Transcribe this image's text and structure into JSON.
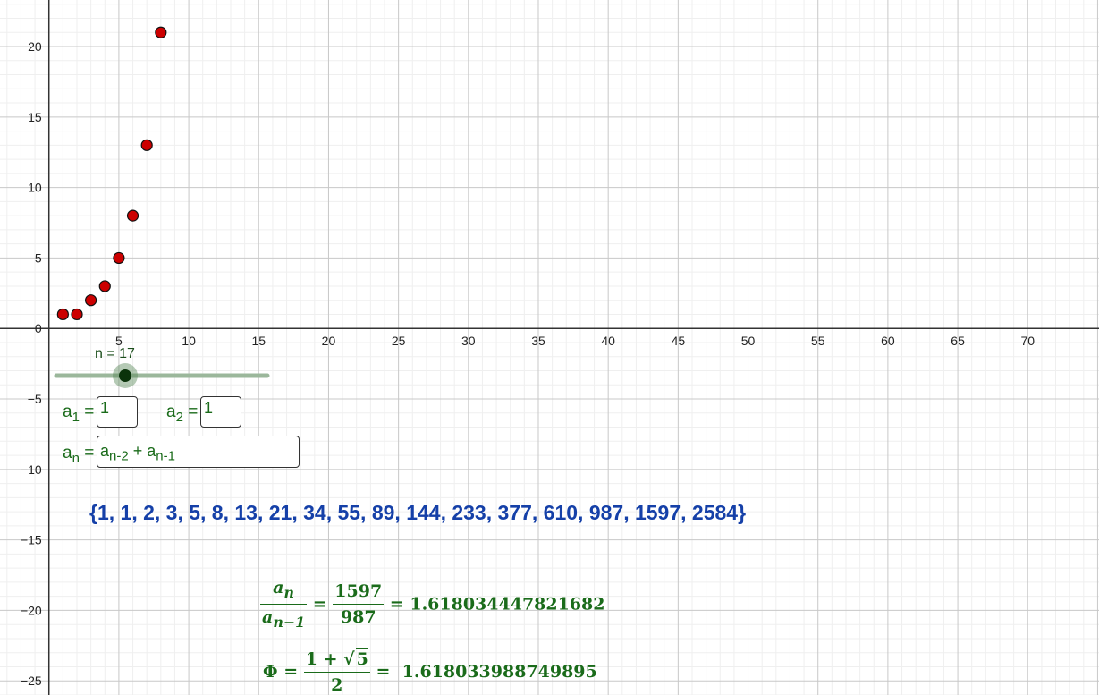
{
  "graphics_view": {
    "x_tick_labels": [
      "5",
      "10",
      "15",
      "20",
      "25",
      "30",
      "35",
      "40",
      "45",
      "50",
      "55",
      "60",
      "65",
      "70"
    ],
    "y_tick_labels": [
      "20",
      "15",
      "10",
      "5",
      "0",
      "−5",
      "−10",
      "−15",
      "−20",
      "−25"
    ],
    "x_range": [
      -3.5,
      75.1
    ],
    "y_range": [
      -26,
      23.3
    ],
    "grid": true,
    "point_color": "#cc0000"
  },
  "chart_data": {
    "type": "scatter",
    "points": [
      {
        "x": 1,
        "y": 1
      },
      {
        "x": 2,
        "y": 1
      },
      {
        "x": 3,
        "y": 2
      },
      {
        "x": 4,
        "y": 3
      },
      {
        "x": 5,
        "y": 5
      },
      {
        "x": 6,
        "y": 8
      },
      {
        "x": 7,
        "y": 13
      },
      {
        "x": 8,
        "y": 21
      }
    ]
  },
  "slider": {
    "label": "n = 17",
    "value": 17
  },
  "inputs": {
    "a1": {
      "label_base": "a",
      "label_sub": "1",
      "value": "1"
    },
    "a2": {
      "label_base": "a",
      "label_sub": "2",
      "value": "1"
    },
    "an": {
      "label_base": "a",
      "label_sub": "n",
      "value_part1": "a",
      "value_sub1": "n-2",
      "value_mid": " + a",
      "value_sub2": "n-1"
    }
  },
  "sequence_text": "{1, 1, 2, 3, 5, 8, 13, 21, 34, 55, 89, 144, 233, 377, 610, 987, 1597, 2584}",
  "ratio": {
    "num_symbol": "a",
    "num_sub": "n",
    "den_symbol": "a",
    "den_sub": "n−1",
    "numerator": "1597",
    "denominator": "987",
    "value": "1.618034447821682"
  },
  "phi": {
    "symbol": "Φ",
    "num_text": "1 + √",
    "num_radicand": "5",
    "denominator": "2",
    "value": "1.618033988749895"
  },
  "colors": {
    "sequence": "#1540a8",
    "math": "#1a6b1a",
    "slider": "#1a5a1a"
  }
}
